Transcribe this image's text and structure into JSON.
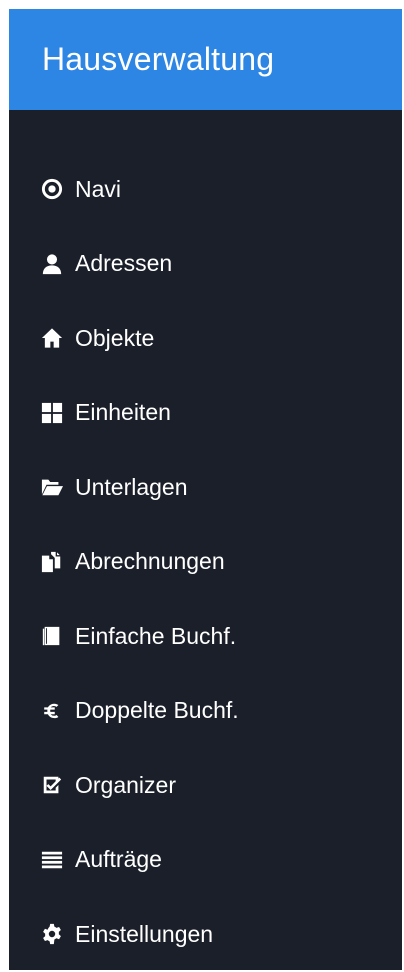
{
  "app": {
    "title": "Hausverwaltung",
    "brand_color": "#2d86e4",
    "sidebar_color": "#1b1f2a"
  },
  "menu": [
    {
      "label": "Navi",
      "icon": "target-icon"
    },
    {
      "label": "Adressen",
      "icon": "user-icon"
    },
    {
      "label": "Objekte",
      "icon": "home-icon"
    },
    {
      "label": "Einheiten",
      "icon": "grid-icon"
    },
    {
      "label": "Unterlagen",
      "icon": "folder-open-icon"
    },
    {
      "label": "Abrechnungen",
      "icon": "documents-icon"
    },
    {
      "label": "Einfache Buchf.",
      "icon": "book-icon"
    },
    {
      "label": "Doppelte Buchf.",
      "icon": "euro-icon"
    },
    {
      "label": "Organizer",
      "icon": "checkbox-icon"
    },
    {
      "label": "Aufträge",
      "icon": "list-icon"
    },
    {
      "label": "Einstellungen",
      "icon": "gear-icon"
    }
  ]
}
